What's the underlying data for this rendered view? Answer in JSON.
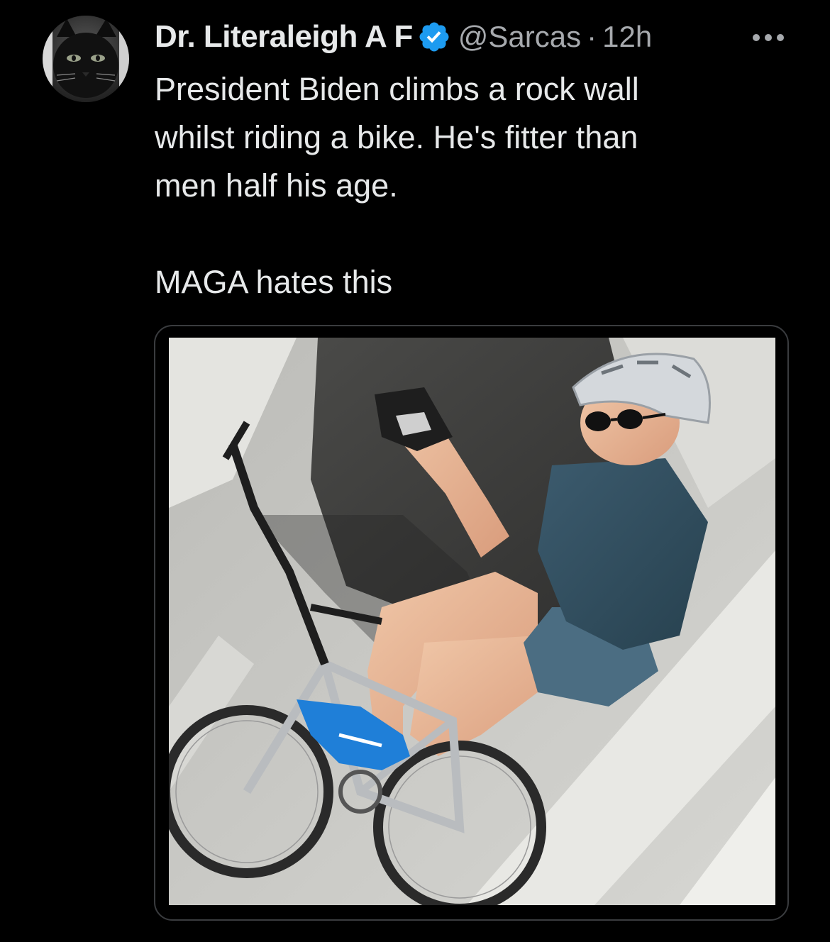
{
  "tweet": {
    "display_name": "Dr. Literaleigh A F",
    "handle": "@Sarcas",
    "separator": "·",
    "time": "12h",
    "text": "President Biden climbs a rock wall\nwhilst riding a bike. He's fitter than\nmen half his age.\n\nMAGA hates this",
    "verified_icon": "verified-badge-icon",
    "more_icon": "more-options-icon"
  },
  "colors": {
    "background": "#000000",
    "text": "#e7e9ea",
    "secondary_text": "#a6a9ad",
    "verified_blue": "#1d9bf0",
    "media_border": "#3a3c3f"
  }
}
